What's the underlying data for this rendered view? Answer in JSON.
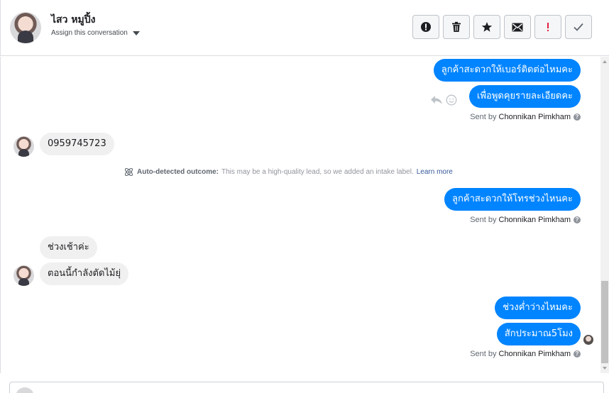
{
  "header": {
    "contact_name": "ไสว หมูปิ้ง",
    "assign_label": "Assign this conversation",
    "toolbar": [
      {
        "name": "report-button",
        "icon": "alert-circle-icon",
        "color": "#1c1e21"
      },
      {
        "name": "delete-button",
        "icon": "trash-icon",
        "color": "#1c1e21"
      },
      {
        "name": "star-button",
        "icon": "star-icon",
        "color": "#1c1e21"
      },
      {
        "name": "mark-unread-button",
        "icon": "envelope-icon",
        "color": "#1c1e21"
      },
      {
        "name": "follow-up-button",
        "icon": "exclamation-icon",
        "color": "#e41e3f"
      },
      {
        "name": "done-button",
        "icon": "check-icon",
        "color": "#606770"
      }
    ]
  },
  "messages": {
    "out_1a": "ลูกค้าสะดวกให้เบอร์ติดต่อไหมคะ",
    "out_1b": "เพื่อพูดคุยรายละเอียดคะ",
    "in_1": "0959745723",
    "out_2": "ลูกค้าสะดวกให้โทรช่วงไหนคะ",
    "in_2a": "ช่วงเช้าค่ะ",
    "in_2b": "ตอนนี้กำลังตัดไม้ยุ่",
    "out_3a": "ช่วงค่ำว่างไหมคะ",
    "out_3b": "สักประมาณ5โมง"
  },
  "sent_by": {
    "prefix": "Sent by",
    "agent": "Chonnikan Pimkham",
    "help": "?"
  },
  "auto_note": {
    "title": "Auto-detected outcome:",
    "body": "This may be a high-quality lead, so we added an intake label.",
    "link": "Learn more"
  },
  "composer": {
    "value": "",
    "placeholder": ""
  },
  "colors": {
    "outgoing_bubble": "#0084ff",
    "incoming_bubble": "#f1f0f0",
    "link": "#365899"
  }
}
